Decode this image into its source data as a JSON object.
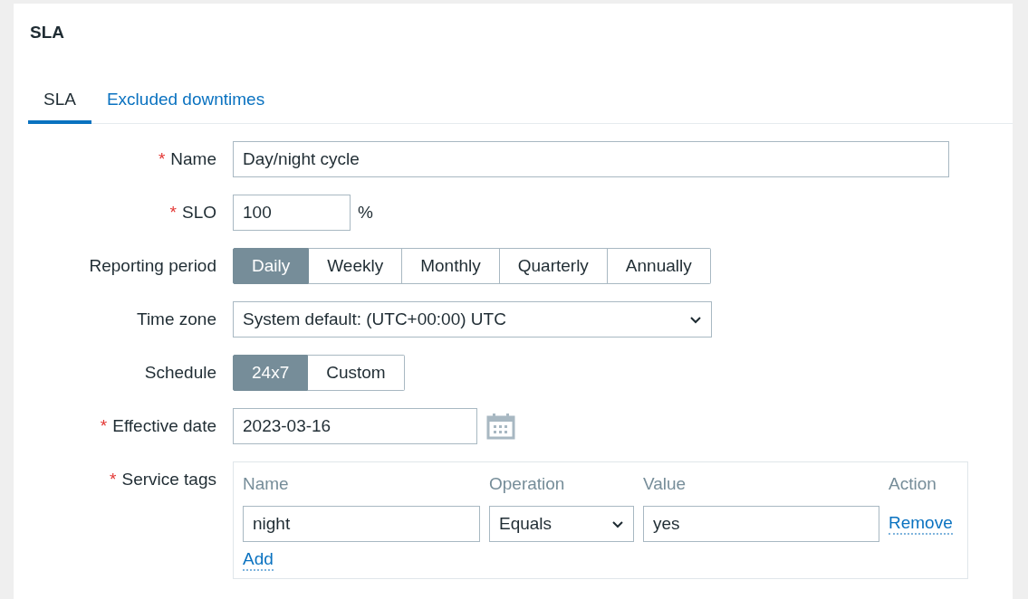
{
  "title": "SLA",
  "tabs": [
    {
      "label": "SLA",
      "selected": true
    },
    {
      "label": "Excluded downtimes",
      "selected": false
    }
  ],
  "fields": [
    {
      "kind": "text",
      "label": "Name",
      "required_mark": "*",
      "value": "Day/night cycle"
    },
    {
      "kind": "number",
      "label": "SLO",
      "required_mark": "*",
      "value": "100",
      "suffix": "%"
    },
    {
      "kind": "segmented",
      "label": "Reporting period",
      "options": [
        {
          "label": "Daily",
          "selected": true
        },
        {
          "label": "Weekly",
          "selected": false
        },
        {
          "label": "Monthly",
          "selected": false
        },
        {
          "label": "Quarterly",
          "selected": false
        },
        {
          "label": "Annually",
          "selected": false
        }
      ]
    },
    {
      "kind": "select",
      "label": "Time zone",
      "value": "System default: (UTC+00:00) UTC"
    },
    {
      "kind": "segmented",
      "label": "Schedule",
      "options": [
        {
          "label": "24x7",
          "selected": true
        },
        {
          "label": "Custom",
          "selected": false
        }
      ]
    },
    {
      "kind": "date",
      "label": "Effective date",
      "required_mark": "*",
      "value": "2023-03-16"
    },
    {
      "kind": "tags",
      "label": "Service tags",
      "required_mark": "*",
      "columns": [
        "Name",
        "Operation",
        "Value",
        "Action"
      ],
      "rows": [
        {
          "name": "night",
          "operation": "Equals",
          "value": "yes",
          "action": "Remove"
        }
      ],
      "add": "Add"
    }
  ]
}
